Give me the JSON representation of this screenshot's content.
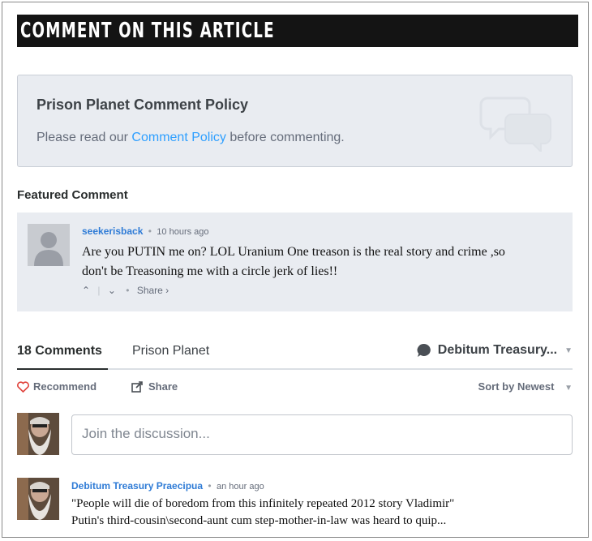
{
  "header": {
    "title": "COMMENT ON THIS ARTICLE"
  },
  "policy": {
    "title": "Prison Planet Comment Policy",
    "text_before": "Please read our ",
    "link": "Comment Policy",
    "text_after": " before commenting."
  },
  "featured": {
    "heading": "Featured Comment",
    "username": "seekerisback",
    "time": "10 hours ago",
    "body_line1": "Are you PUTIN me on? LOL Uranium One treason is the real story and crime ,so",
    "body_line2": "don't be Treasoning me with a circle jerk of lies!!",
    "share": "Share ›"
  },
  "tabs": {
    "comments": "18 Comments",
    "forum": "Prison Planet",
    "user": "Debitum Treasury..."
  },
  "toolbar": {
    "recommend": "Recommend",
    "share": "Share",
    "sort": "Sort by Newest"
  },
  "composer": {
    "placeholder": "Join the discussion..."
  },
  "comment": {
    "username": "Debitum Treasury Praecipua",
    "time": "an hour ago",
    "line1": "\"People will die of boredom from this infinitely repeated 2012 story Vladimir\"",
    "line2": "Putin's third-cousin\\second-aunt cum step-mother-in-law was heard to quip..."
  },
  "colors": {
    "link": "#2e9fff",
    "username": "#2e7bd6",
    "heart": "#e0423b"
  }
}
